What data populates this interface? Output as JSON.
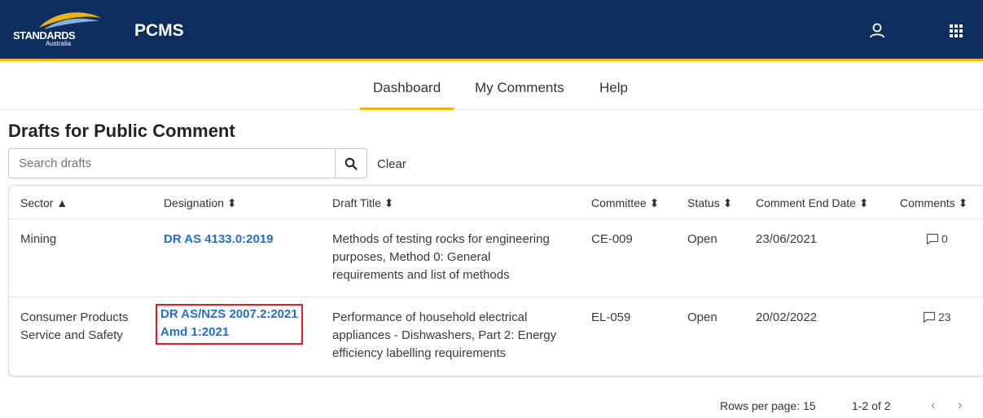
{
  "header": {
    "logo_line1": "STANDARDS",
    "logo_line2": "Australia",
    "app_title": "PCMS"
  },
  "nav": {
    "tabs": [
      "Dashboard",
      "My Comments",
      "Help"
    ],
    "active": "Dashboard"
  },
  "page": {
    "title": "Drafts for Public Comment"
  },
  "search": {
    "placeholder": "Search drafts",
    "value": "",
    "clear_label": "Clear"
  },
  "table": {
    "columns": [
      "Sector ▲",
      "Designation ⬍",
      "Draft Title ⬍",
      "Committee ⬍",
      "Status ⬍",
      "Comment End Date ⬍",
      "Comments ⬍"
    ],
    "rows": [
      {
        "sector": [
          "Mining"
        ],
        "designation": [
          "DR AS 4133.0:2019"
        ],
        "title": [
          "Methods of testing rocks for engineering",
          "purposes, Method 0: General",
          "requirements and list of methods"
        ],
        "committee": "CE-009",
        "status": "Open",
        "end_date": "23/06/2021",
        "comments": "0"
      },
      {
        "sector": [
          "Consumer Products",
          "Service and Safety"
        ],
        "designation": [
          "DR AS/NZS 2007.2:2021",
          "Amd 1:2021"
        ],
        "title": [
          "Performance of household electrical",
          "appliances - Dishwashers, Part 2: Energy",
          "efficiency labelling requirements"
        ],
        "committee": "EL-059",
        "status": "Open",
        "end_date": "20/02/2022",
        "comments": "23"
      }
    ]
  },
  "pagination": {
    "rows_per_page_label": "Rows per page: 15",
    "range": "1-2 of 2",
    "prev": "‹",
    "next": "›"
  },
  "colors": {
    "header_bg": "#0d2e5e",
    "accent": "#f5b400",
    "link": "#1f6fd1",
    "highlight_box": "#e01e1e"
  }
}
